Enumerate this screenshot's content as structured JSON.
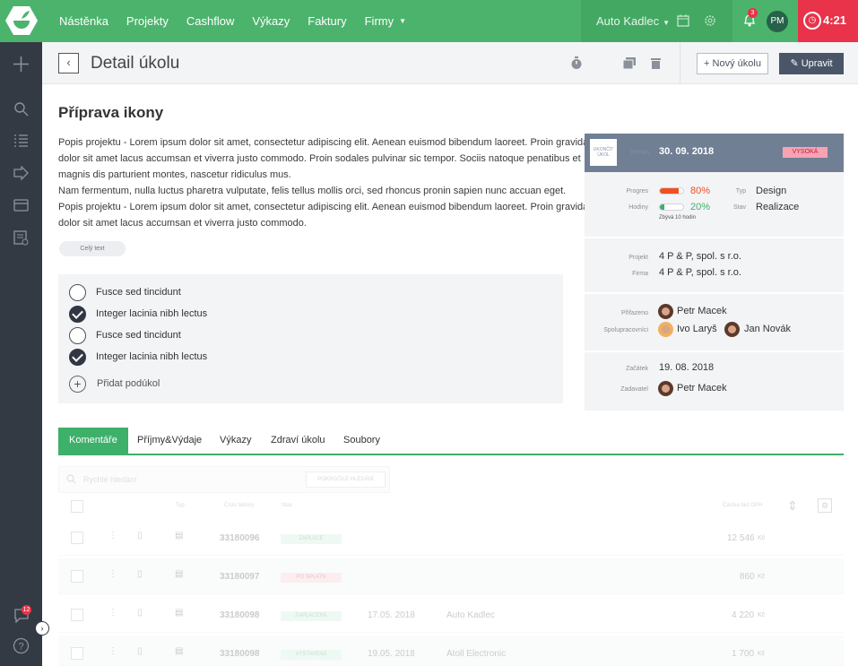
{
  "nav": {
    "items": [
      "Nástěnka",
      "Projekty",
      "Cashflow",
      "Výkazy",
      "Faktury",
      "Firmy"
    ]
  },
  "top": {
    "company": "Auto Kadlec",
    "notifications": "3",
    "user_initials": "PM",
    "timer": "4:21"
  },
  "sidebar": {
    "chat_badge": "12"
  },
  "header": {
    "title": "Detail úkolu",
    "new_task_label": "+ Nový úkolu",
    "edit_label": "✎ Upravit"
  },
  "task": {
    "title": "Příprava ikony",
    "description": [
      "Popis projektu - Lorem ipsum dolor sit amet, consectetur adipiscing elit. Aenean euismod bibendum laoreet. Proin gravida",
      "dolor sit amet lacus accumsan et viverra justo commodo. Proin sodales pulvinar sic tempor. Sociis natoque penatibus et",
      "magnis dis parturient montes, nascetur ridiculus mus.",
      "Nam fermentum, nulla luctus pharetra vulputate, felis tellus mollis orci, sed rhoncus pronin sapien nunc accuan eget.",
      "Popis projektu - Lorem ipsum dolor sit amet, consectetur adipiscing elit. Aenean euismod bibendum laoreet. Proin gravida",
      "dolor sit amet lacus accumsan et viverra justo commodo."
    ],
    "full_text_label": "Celý text",
    "subtasks": [
      {
        "label": "Fusce sed tincidunt",
        "done": false
      },
      {
        "label": "Integer lacinia nibh lectus",
        "done": true
      },
      {
        "label": "Fusce sed tincidunt",
        "done": false
      },
      {
        "label": "Integer lacinia nibh lectus",
        "done": true
      }
    ],
    "add_subtask_label": "Přidat podúkol"
  },
  "card": {
    "finish_label": "UKONČIT ÚKOL",
    "deadline_label": "Termín",
    "deadline": "30. 09. 2018",
    "priority": "VYSOKÁ",
    "progress_label": "Progres",
    "progress": "80%",
    "progress_value": 0.8,
    "hours_label": "Hodiny",
    "hours": "20%",
    "hours_value": 0.2,
    "hours_note": "Zbývá 10 hodin",
    "type_label": "Typ",
    "type": "Design",
    "state_label": "Stav",
    "state": "Realizace",
    "project_label": "Projekt",
    "project": "4 P & P, spol. s r.o.",
    "firm_label": "Firma",
    "firm": "4 P & P, spol. s r.o.",
    "assigned_label": "Přiřazeno",
    "assigned": "Petr Macek",
    "collab_label": "Spolupracovníci",
    "collab1": "Ivo Laryš",
    "collab2": "Jan Novák",
    "start_label": "Začátek",
    "start": "19. 08. 2018",
    "author_label": "Zadavatel",
    "author": "Petr Macek",
    "colors": {
      "progress": "#f04e23",
      "hours": "#3db06a"
    }
  },
  "tabs": [
    "Komentáře",
    "Příjmy&Výdaje",
    "Výkazy",
    "Zdraví úkolu",
    "Soubory"
  ],
  "table": {
    "search_placeholder": "Rychlé hledání",
    "advanced_search": "POKROČILÉ HLEDÁNÍ",
    "headers": {
      "type": "Typ",
      "invoice_no": "Číslo faktury",
      "status": "Stav",
      "amount": "Částka bez DPH"
    },
    "rows": [
      {
        "no": "33180096",
        "status": "ZAPLACE",
        "status_type": "g",
        "date": "",
        "company": "",
        "amount": "12 546",
        "currency": "Kč"
      },
      {
        "no": "33180097",
        "status": "PO SPLATN",
        "status_type": "r",
        "date": "",
        "company": "",
        "amount": "860",
        "currency": "Kč"
      },
      {
        "no": "33180098",
        "status": "ZAPLACENÁ",
        "status_type": "g",
        "date": "17.05. 2018",
        "company": "Auto Kadlec",
        "amount": "4 220",
        "currency": "Kč"
      },
      {
        "no": "33180098",
        "status": "VYSTAVENÁ",
        "status_type": "g",
        "date": "19.05. 2018",
        "company": "Atoll Electronic",
        "amount": "1 700",
        "currency": "Kč"
      }
    ]
  }
}
